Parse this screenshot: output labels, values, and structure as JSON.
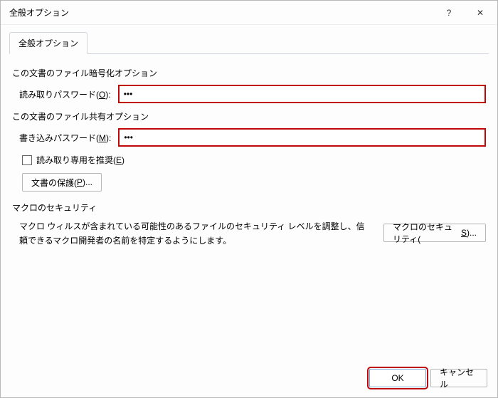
{
  "window": {
    "title": "全般オプション"
  },
  "tab": {
    "label": "全般オプション"
  },
  "encrypt": {
    "section": "この文書のファイル暗号化オプション",
    "label_before": "読み取りパスワード(",
    "label_accel": "O",
    "label_after": "):",
    "value": "***"
  },
  "share": {
    "section": "この文書のファイル共有オプション",
    "label_before": "書き込みパスワード(",
    "label_accel": "M",
    "label_after": "):",
    "value": "***"
  },
  "readonly": {
    "label_before": "読み取り専用を推奨(",
    "label_accel": "E",
    "label_after": ")"
  },
  "protect": {
    "label_before": "文書の保護(",
    "label_accel": "P",
    "label_after": ")..."
  },
  "macro": {
    "section": "マクロのセキュリティ",
    "desc": "マクロ ウィルスが含まれている可能性のあるファイルのセキュリティ レベルを調整し、信頼できるマクロ開発者の名前を特定するようにします。",
    "button_before": "マクロのセキュリティ(",
    "button_accel": "S",
    "button_after": ")..."
  },
  "footer": {
    "ok": "OK",
    "cancel": "キャンセル"
  },
  "icons": {
    "help": "?",
    "close": "✕"
  }
}
